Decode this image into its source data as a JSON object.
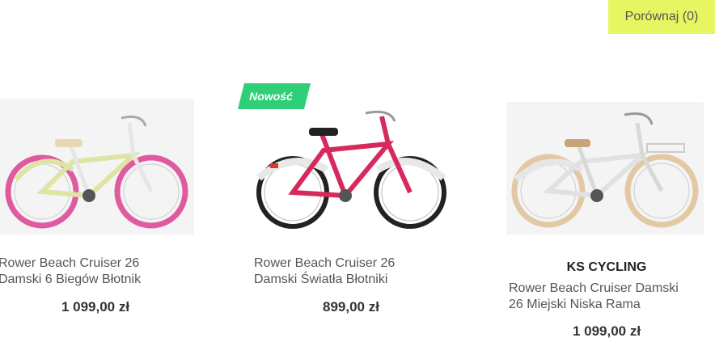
{
  "compare": {
    "label": "Porównaj (0)"
  },
  "products": [
    {
      "name_line1": "Rower Beach Cruiser 26",
      "name_line2": "Damski 6 Biegów Błotnik",
      "price": "1 099,00 zł",
      "frame_color": "#d9e0a0",
      "tire_color": "#e05aa0"
    },
    {
      "name_line1": "Rower Beach Cruiser 26",
      "name_line2": "Damski Światła Błotniki",
      "price": "899,00 zł",
      "badge": "Nowość",
      "frame_color": "#d62a5c",
      "tire_color": "#222222"
    },
    {
      "brand": "KS CYCLING",
      "name_line1": "Rower Beach Cruiser Damski",
      "name_line2": "26 Miejski Niska Rama",
      "price": "1 099,00 zł",
      "frame_color": "#e8e8e8",
      "tire_color": "#e2c9a4"
    }
  ],
  "colors": {
    "compare_bg": "#e6f562",
    "badge_bg": "#2ecf77"
  }
}
